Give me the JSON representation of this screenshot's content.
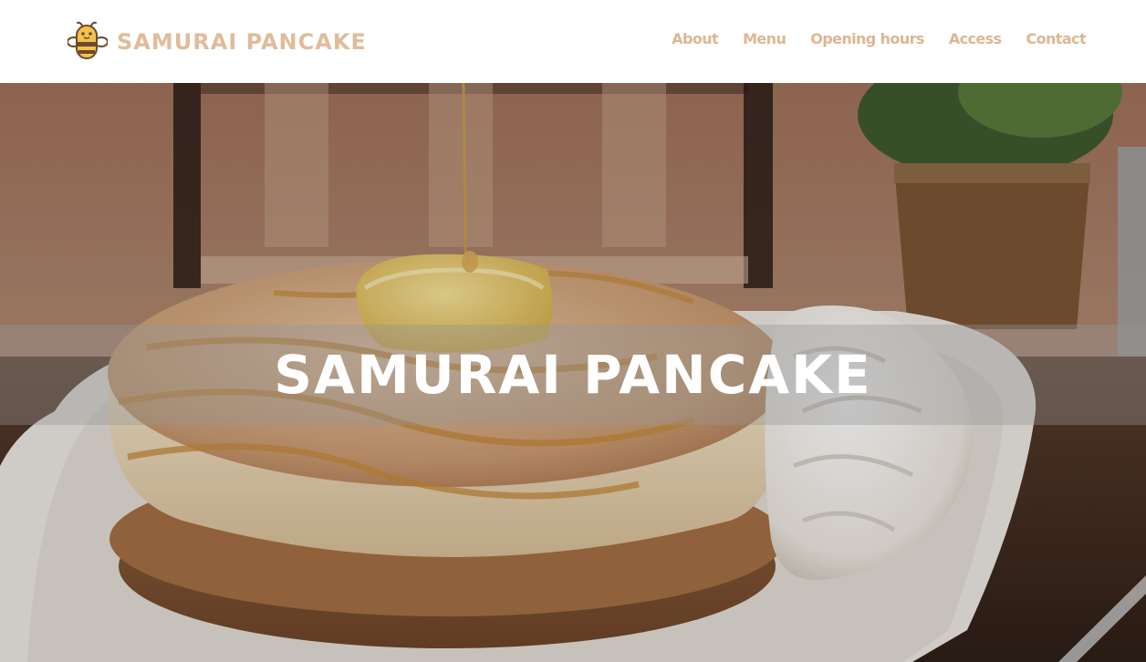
{
  "header": {
    "brand_name": "SAMURAI PANCAKE",
    "logo_icon": "bee-icon",
    "nav": [
      {
        "label": "About"
      },
      {
        "label": "Menu"
      },
      {
        "label": "Opening hours"
      },
      {
        "label": "Access"
      },
      {
        "label": "Contact"
      }
    ]
  },
  "hero": {
    "title": "SAMURAI PANCAKE",
    "image": "pancake-stack-with-butter-syrup-and-whipped-cream"
  },
  "colors": {
    "brand": "#e0bc9a",
    "nav_text": "#dcb692",
    "logo_yellow": "#f3c24a",
    "logo_dark": "#6b4a2e",
    "overlay_band": "rgba(150,150,150,0.38)"
  }
}
